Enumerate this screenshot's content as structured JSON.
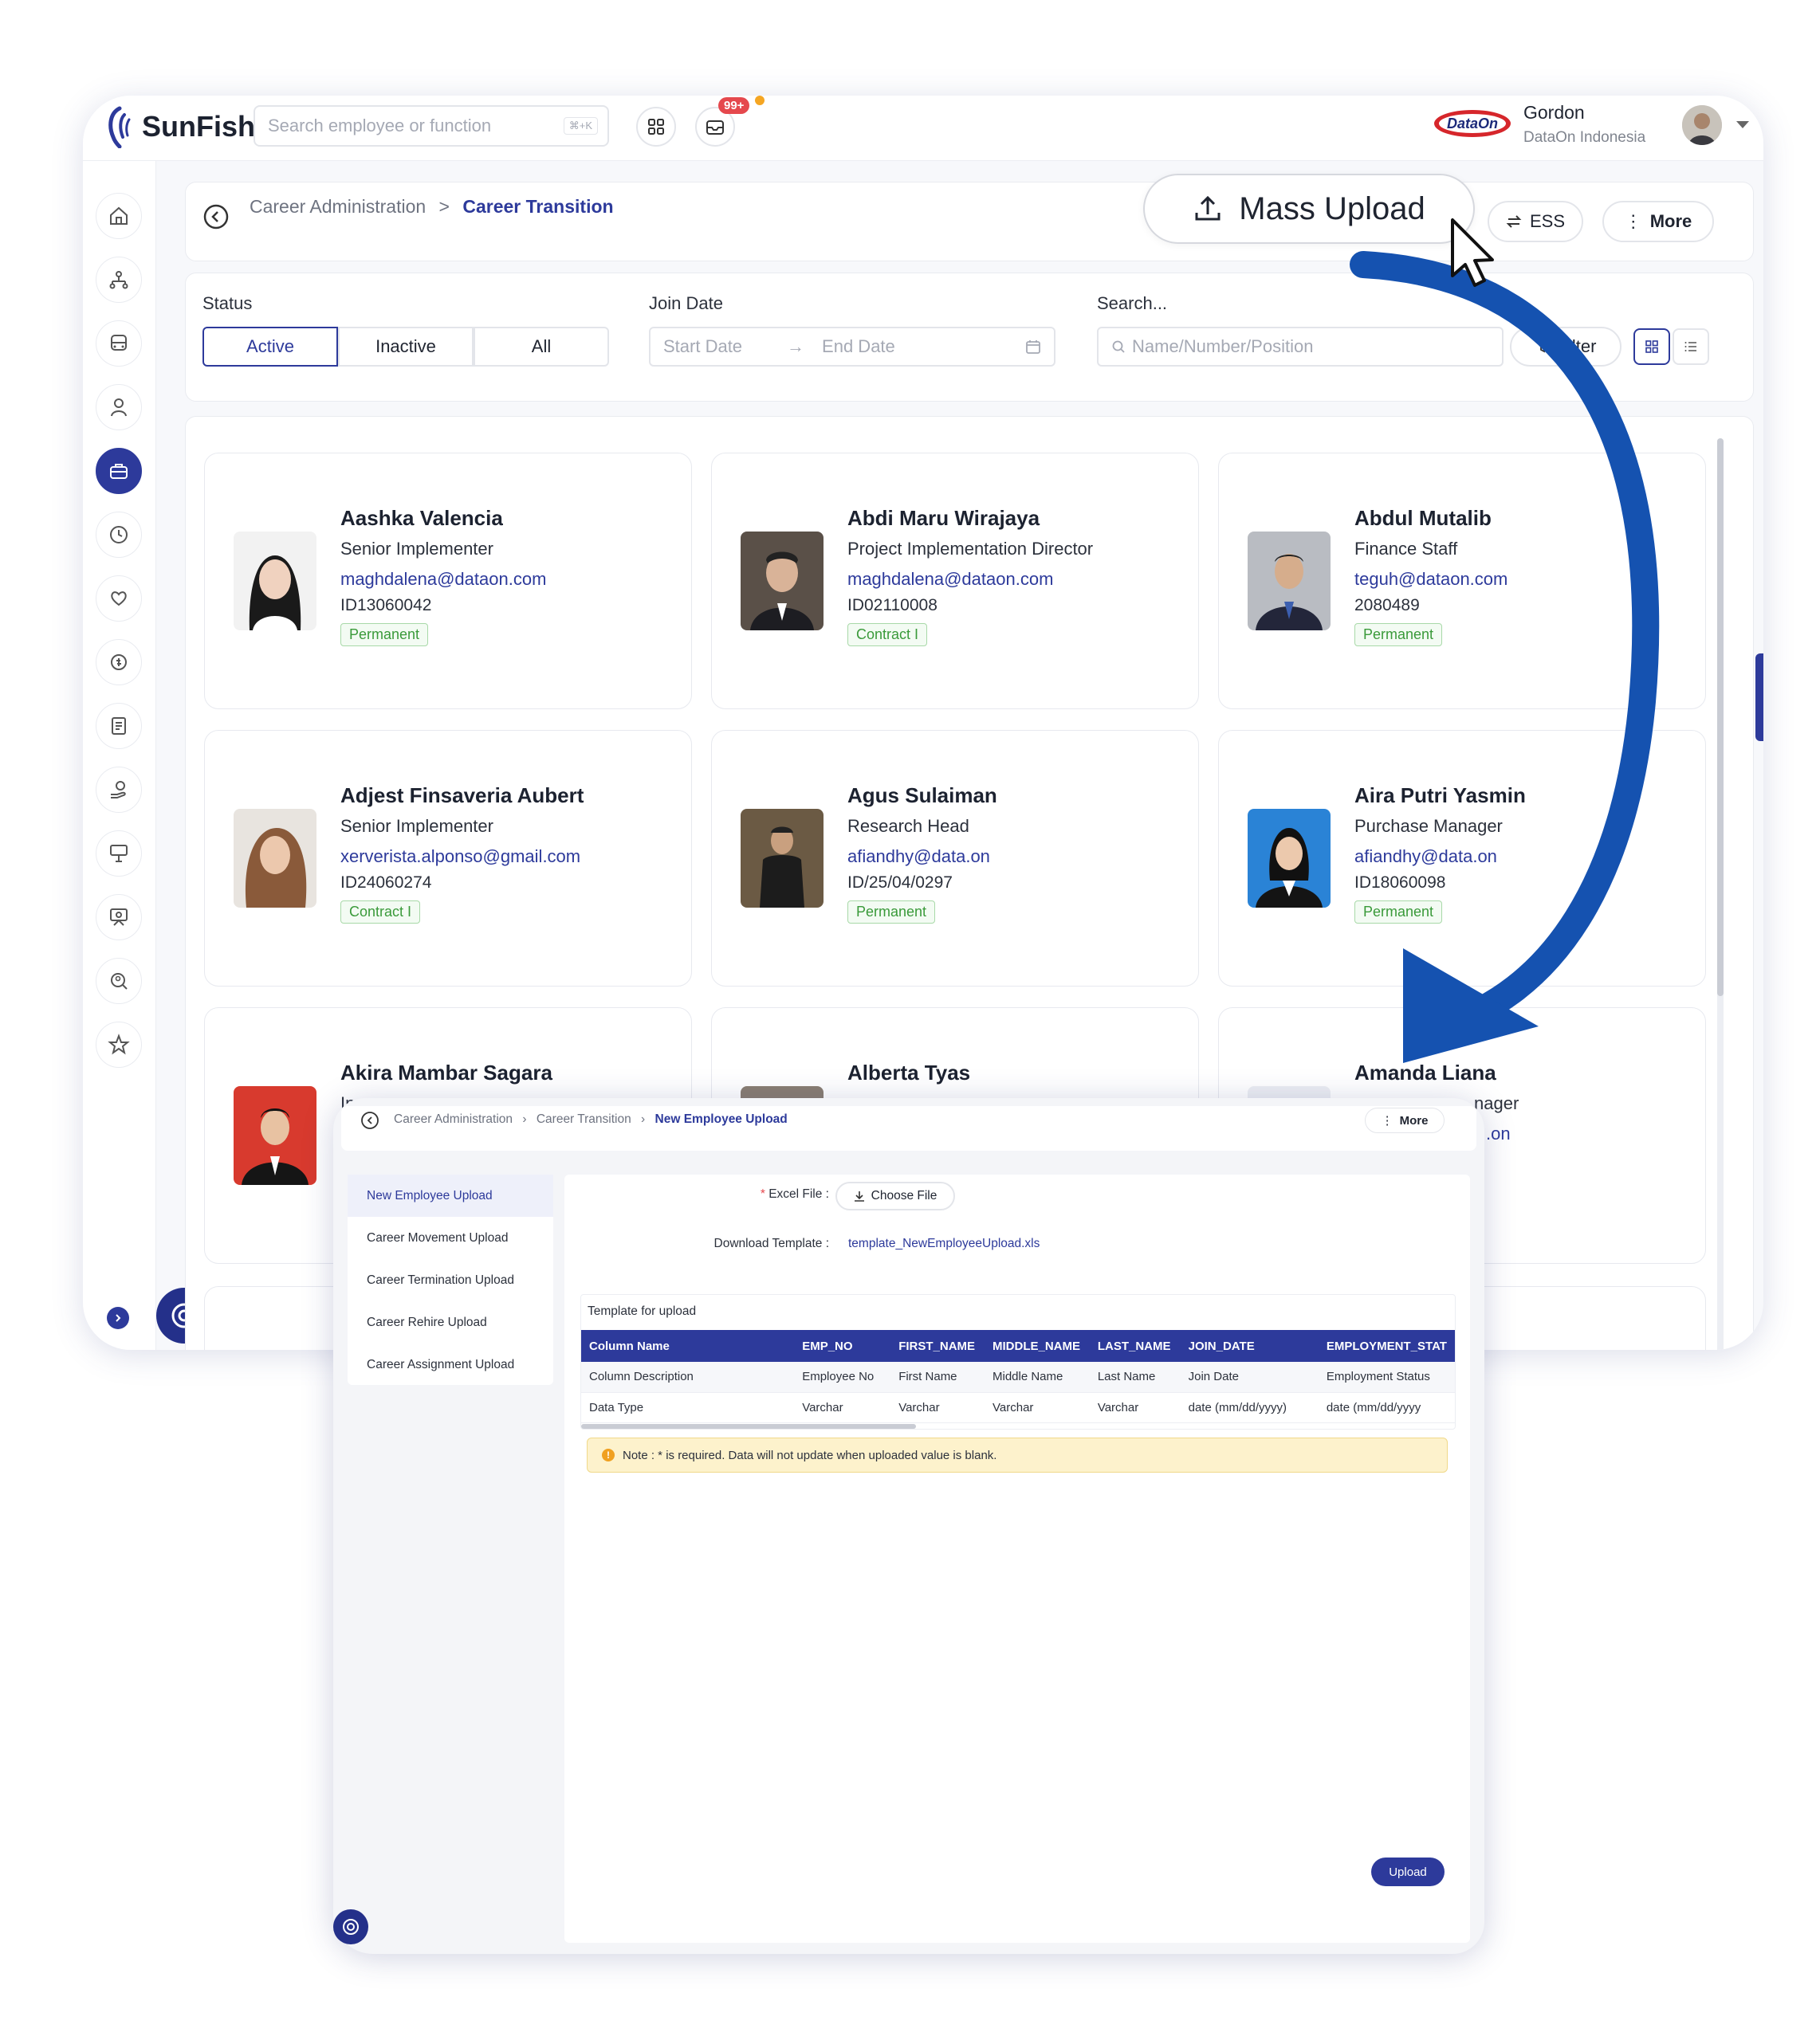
{
  "topbar": {
    "logo_text": "SunFish",
    "search_placeholder": "Search employee or function",
    "search_shortcut": "⌘+K",
    "notif_count": "99+",
    "brand_logo_text": "DataOn",
    "user_name": "Gordon",
    "user_company": "DataOn Indonesia"
  },
  "breadcrumb": {
    "parent": "Career Administration",
    "separator": ">",
    "current": "Career Transition"
  },
  "actions": {
    "mass_upload": "Mass Upload",
    "ess": "ESS",
    "more": "More"
  },
  "filters": {
    "status_label": "Status",
    "status_options": [
      "Active",
      "Inactive",
      "All"
    ],
    "status_selected": "Active",
    "join_date_label": "Join Date",
    "start_placeholder": "Start Date",
    "end_placeholder": "End Date",
    "search_label": "Search...",
    "search_placeholder": "Name/Number/Position",
    "filter_button": "Filter"
  },
  "employees": [
    {
      "name": "Aashka Valencia",
      "title": "Senior Implementer",
      "email": "maghdalena@dataon.com",
      "id": "ID13060042",
      "status": "Permanent"
    },
    {
      "name": "Abdi Maru Wirajaya",
      "title": "Project Implementation Director",
      "email": "maghdalena@dataon.com",
      "id": "ID02110008",
      "status": "Contract I"
    },
    {
      "name": "Abdul Mutalib",
      "title": "Finance Staff",
      "email": "teguh@dataon.com",
      "id": "2080489",
      "status": "Permanent"
    },
    {
      "name": "Adjest Finsaveria Aubert",
      "title": "Senior Implementer",
      "email": "xerverista.alponso@gmail.com",
      "id": "ID24060274",
      "status": "Contract I"
    },
    {
      "name": "Agus Sulaiman",
      "title": "Research Head",
      "email": "afiandhy@data.on",
      "id": "ID/25/04/0297",
      "status": "Permanent"
    },
    {
      "name": "Aira Putri Yasmin",
      "title": "Purchase Manager",
      "email": "afiandhy@data.on",
      "id": "ID18060098",
      "status": "Permanent"
    },
    {
      "name": "Akira Mambar Sagara",
      "title": "Inv",
      "email": "",
      "id": "",
      "status": ""
    },
    {
      "name": "Alberta Tyas",
      "title": "",
      "email": "",
      "id": "",
      "status": ""
    },
    {
      "name": "Amanda Liana",
      "title": "nager",
      "email": ".on",
      "id": "",
      "status": ""
    }
  ],
  "upload_window": {
    "breadcrumb": [
      "Career Administration",
      "Career Transition",
      "New Employee Upload"
    ],
    "more": "More",
    "menu": [
      "New Employee Upload",
      "Career Movement Upload",
      "Career Termination Upload",
      "Career Rehire Upload",
      "Career Assignment Upload"
    ],
    "menu_selected": "New Employee Upload",
    "excel_file_label": "Excel File :",
    "required_mark": "*",
    "choose_file": "Choose File",
    "download_template_label": "Download Template :",
    "template_link": "template_NewEmployeeUpload.xls",
    "template_title": "Template for upload",
    "table": {
      "headers": [
        "Column Name",
        "EMP_NO",
        "FIRST_NAME",
        "MIDDLE_NAME",
        "LAST_NAME",
        "JOIN_DATE",
        "EMPLOYMENT_STAT"
      ],
      "rows": [
        [
          "Column Description",
          "Employee No",
          "First Name",
          "Middle Name",
          "Last Name",
          "Join Date",
          "Employment Status"
        ],
        [
          "Data Type",
          "Varchar",
          "Varchar",
          "Varchar",
          "Varchar",
          "date (mm/dd/yyyy)",
          "date (mm/dd/yyyy"
        ]
      ]
    },
    "note": "Note : * is required. Data will not update when uploaded value is blank.",
    "upload_button": "Upload"
  },
  "colors": {
    "primary": "#2d3a9b",
    "arrow": "#1552b0",
    "badge_green": "#3a9a3a",
    "notif_red": "#e5484d"
  }
}
